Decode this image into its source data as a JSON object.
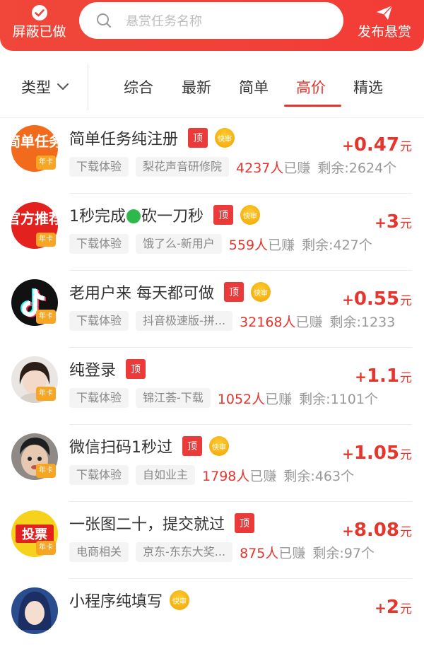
{
  "header": {
    "hide_done_label": "屏蔽已做",
    "search_placeholder": "悬赏任务名称",
    "publish_label": "发布悬赏"
  },
  "filter": {
    "type_label": "类型",
    "tabs": [
      "综合",
      "最新",
      "简单",
      "高价",
      "精选"
    ],
    "active_tab": "高价"
  },
  "badges": {
    "top": "顶",
    "fast": "快审",
    "year": "年卡"
  },
  "avatars": {
    "a0": "简单任务",
    "a1": "官方推荐",
    "a5": "投票"
  },
  "tasks": [
    {
      "title": "简单任务纯注册",
      "category": "下载体验",
      "app": "梨花声音研修院",
      "earned": "4237人",
      "earned_suffix": "已赚",
      "remain": "剩余:2624个",
      "price_plus": "+",
      "price": "0.47",
      "unit": "元"
    },
    {
      "title_a": "1秒完成",
      "title_b": "砍一刀秒",
      "category": "下载体验",
      "app": "饿了么-新用户",
      "earned": "559人",
      "earned_suffix": "已赚",
      "remain": "剩余:427个",
      "price_plus": "+",
      "price": "3",
      "unit": "元"
    },
    {
      "title": "老用户来 每天都可做",
      "category": "下载体验",
      "app": "抖音极速版-拼...",
      "earned": "32168人",
      "earned_suffix": "已赚",
      "remain": "剩余:1233",
      "price_plus": "+",
      "price": "0.55",
      "unit": "元"
    },
    {
      "title": "纯登录",
      "category": "下载体验",
      "app": "锦江荟-下载",
      "earned": "1052人",
      "earned_suffix": "已赚",
      "remain": "剩余:1101个",
      "price_plus": "+",
      "price": "1.1",
      "unit": "元"
    },
    {
      "title": "微信扫码1秒过",
      "category": "下载体验",
      "app": "自如业主",
      "earned": "1798人",
      "earned_suffix": "已赚",
      "remain": "剩余:463个",
      "price_plus": "+",
      "price": "1.05",
      "unit": "元"
    },
    {
      "title": "一张图二十，提交就过",
      "category": "电商相关",
      "app": "京东-东东大奖...",
      "earned": "875人",
      "earned_suffix": "已赚",
      "remain": "剩余:97个",
      "price_plus": "+",
      "price": "8.08",
      "unit": "元"
    },
    {
      "title": "小程序纯填写",
      "price_plus": "+",
      "price": "2",
      "unit": "元"
    }
  ]
}
